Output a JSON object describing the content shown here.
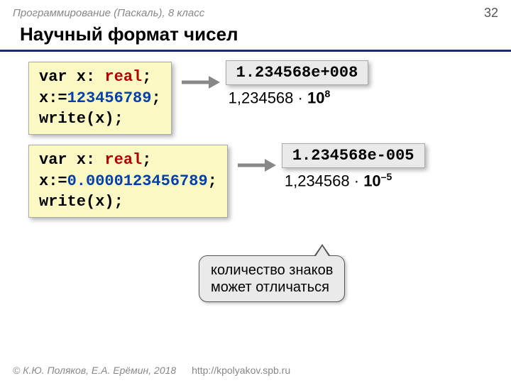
{
  "header": {
    "course": "Программирование (Паскаль), 8 класс",
    "page": "32"
  },
  "title": "Научный формат чисел",
  "row1": {
    "code_l1a": "var x: ",
    "code_l1b": "real",
    "code_l1c": ";",
    "code_l2a": "x:=",
    "code_l2b": "123456789",
    "code_l2c": ";",
    "code_l3": "write(x);",
    "output": "1.234568e+008",
    "math_a": "1,234568 ·",
    "math_b": "10",
    "math_exp": "8"
  },
  "row2": {
    "code_l1a": "var x: ",
    "code_l1b": "real",
    "code_l1c": ";",
    "code_l2a": "x:=",
    "code_l2b": "0.0000123456789",
    "code_l2c": ";",
    "code_l3": "write(x);",
    "output": "1.234568e-005",
    "math_a": "1,234568 ·",
    "math_b": "10",
    "math_exp": "–5"
  },
  "note": {
    "line1": "количество знаков",
    "line2": "может отличаться"
  },
  "footer": {
    "copyright": "© К.Ю. Поляков, Е.А. Ерёмин, 2018",
    "url": "http://kpolyakov.spb.ru"
  }
}
